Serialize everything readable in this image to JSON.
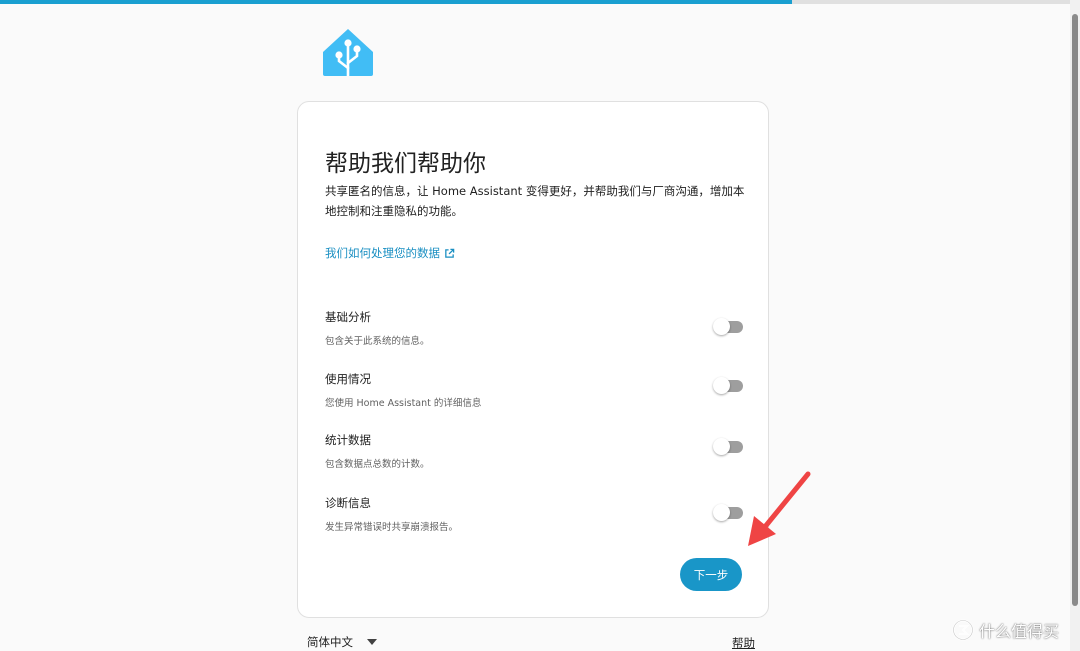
{
  "progress": {
    "fraction": 0.74
  },
  "colors": {
    "accent": "#1996c8",
    "progress": "#1a9fd0",
    "logo": "#41bdf5",
    "arrow": "#ef4444"
  },
  "logo": {
    "icon": "home-assistant-logo-icon"
  },
  "card": {
    "title": "帮助我们帮助你",
    "description": "共享匿名的信息，让 Home Assistant 变得更好，并帮助我们与厂商沟通，增加本地控制和注重隐私的功能。",
    "link": {
      "label": "我们如何处理您的数据",
      "icon": "external-link-icon"
    },
    "settings": [
      {
        "id": "base",
        "title": "基础分析",
        "subtitle": "包含关于此系统的信息。",
        "enabled": false
      },
      {
        "id": "usage",
        "title": "使用情况",
        "subtitle": "您使用 Home Assistant 的详细信息",
        "enabled": false
      },
      {
        "id": "statistics",
        "title": "统计数据",
        "subtitle": "包含数据点总数的计数。",
        "enabled": false
      },
      {
        "id": "diagnostics",
        "title": "诊断信息",
        "subtitle": "发生异常错误时共享崩溃报告。",
        "enabled": false
      }
    ],
    "next_label": "下一步"
  },
  "footer": {
    "language": "简体中文",
    "language_icon": "caret-down-icon",
    "help_label": "帮助"
  },
  "watermark": {
    "text": "什么值得买",
    "icon": "smzdm-logo-icon"
  }
}
